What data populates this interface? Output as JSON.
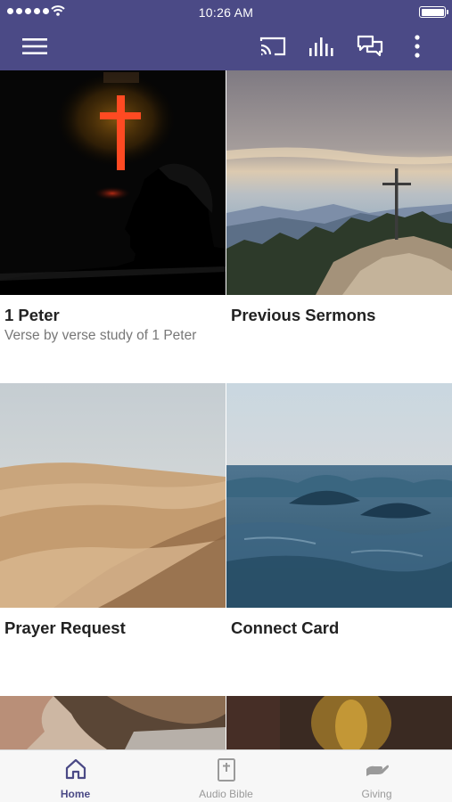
{
  "status_bar": {
    "time": "10:26 AM"
  },
  "colors": {
    "brand": "#4b4a86",
    "tab_inactive": "#9a9a9a"
  },
  "navbar": {
    "menu_icon": "hamburger-icon",
    "actions": [
      "cast-icon",
      "audio-bars-icon",
      "chat-icon",
      "more-vertical-icon"
    ]
  },
  "tiles": [
    {
      "title": "1 Peter",
      "subtitle": "Verse by verse study of 1 Peter"
    },
    {
      "title": "Previous Sermons",
      "subtitle": ""
    },
    {
      "title": "Prayer Request",
      "subtitle": ""
    },
    {
      "title": "Connect Card",
      "subtitle": ""
    }
  ],
  "tabbar": {
    "tabs": [
      {
        "label": "Home",
        "icon": "home-icon",
        "active": true
      },
      {
        "label": "Audio Bible",
        "icon": "bible-icon",
        "active": false
      },
      {
        "label": "Giving",
        "icon": "giving-hand-icon",
        "active": false
      }
    ]
  }
}
